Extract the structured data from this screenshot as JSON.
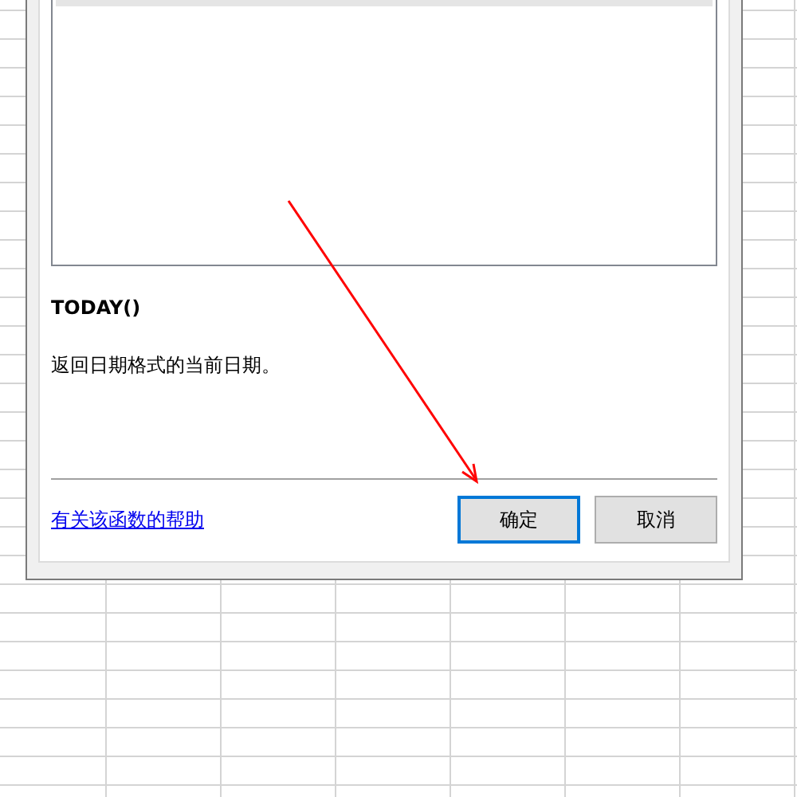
{
  "dialog": {
    "function_list": {
      "selected_row_visible": true
    },
    "function_signature": "TODAY()",
    "function_description": "返回日期格式的当前日期。",
    "help_link": "有关该函数的帮助",
    "buttons": [
      {
        "label": "确定",
        "focused": true
      },
      {
        "label": "取消",
        "focused": false
      }
    ]
  }
}
